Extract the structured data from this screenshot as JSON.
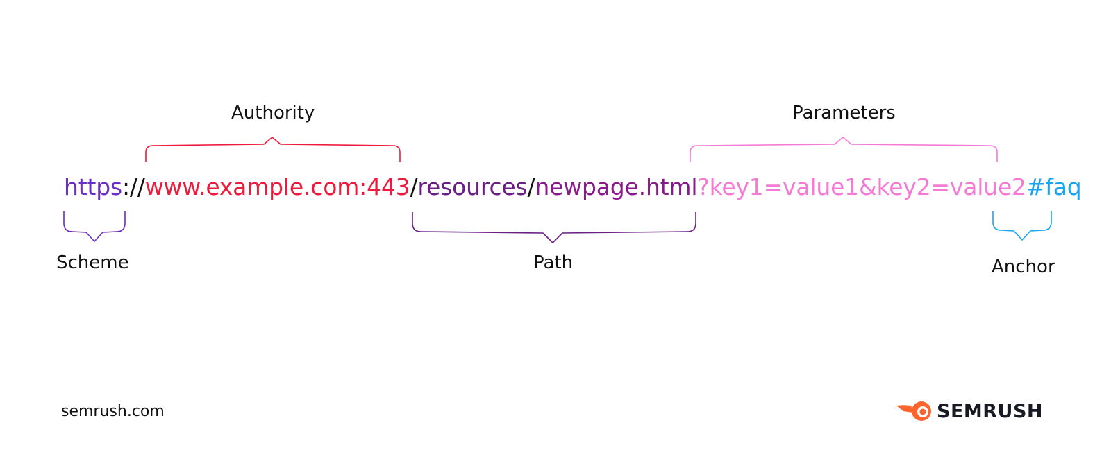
{
  "url": {
    "scheme": "https",
    "scheme_sep": "://",
    "authority": "www.example.com:443",
    "slash1": "/",
    "path_a": "resources",
    "slash2": "/",
    "path_b": "newpage.html",
    "parameters": "?key1=value1&key2=value2",
    "anchor": "#faq"
  },
  "labels": {
    "authority": "Authority",
    "parameters": "Parameters",
    "scheme": "Scheme",
    "path": "Path",
    "anchor": "Anchor"
  },
  "footer": {
    "domain": "semrush.com",
    "brand": "SEMRUSH"
  },
  "colors": {
    "scheme": "#6a2bc6",
    "separator": "#111111",
    "authority": "#ee1a3b",
    "path_a": "#6b1f86",
    "path_b": "#8a1a8c",
    "parameters": "#f57ad6",
    "anchor": "#1aa3f0",
    "brand_orange": "#ff642d",
    "brand_text": "#171a22"
  },
  "icons": {
    "brand_logo": "semrush-flame-icon"
  }
}
